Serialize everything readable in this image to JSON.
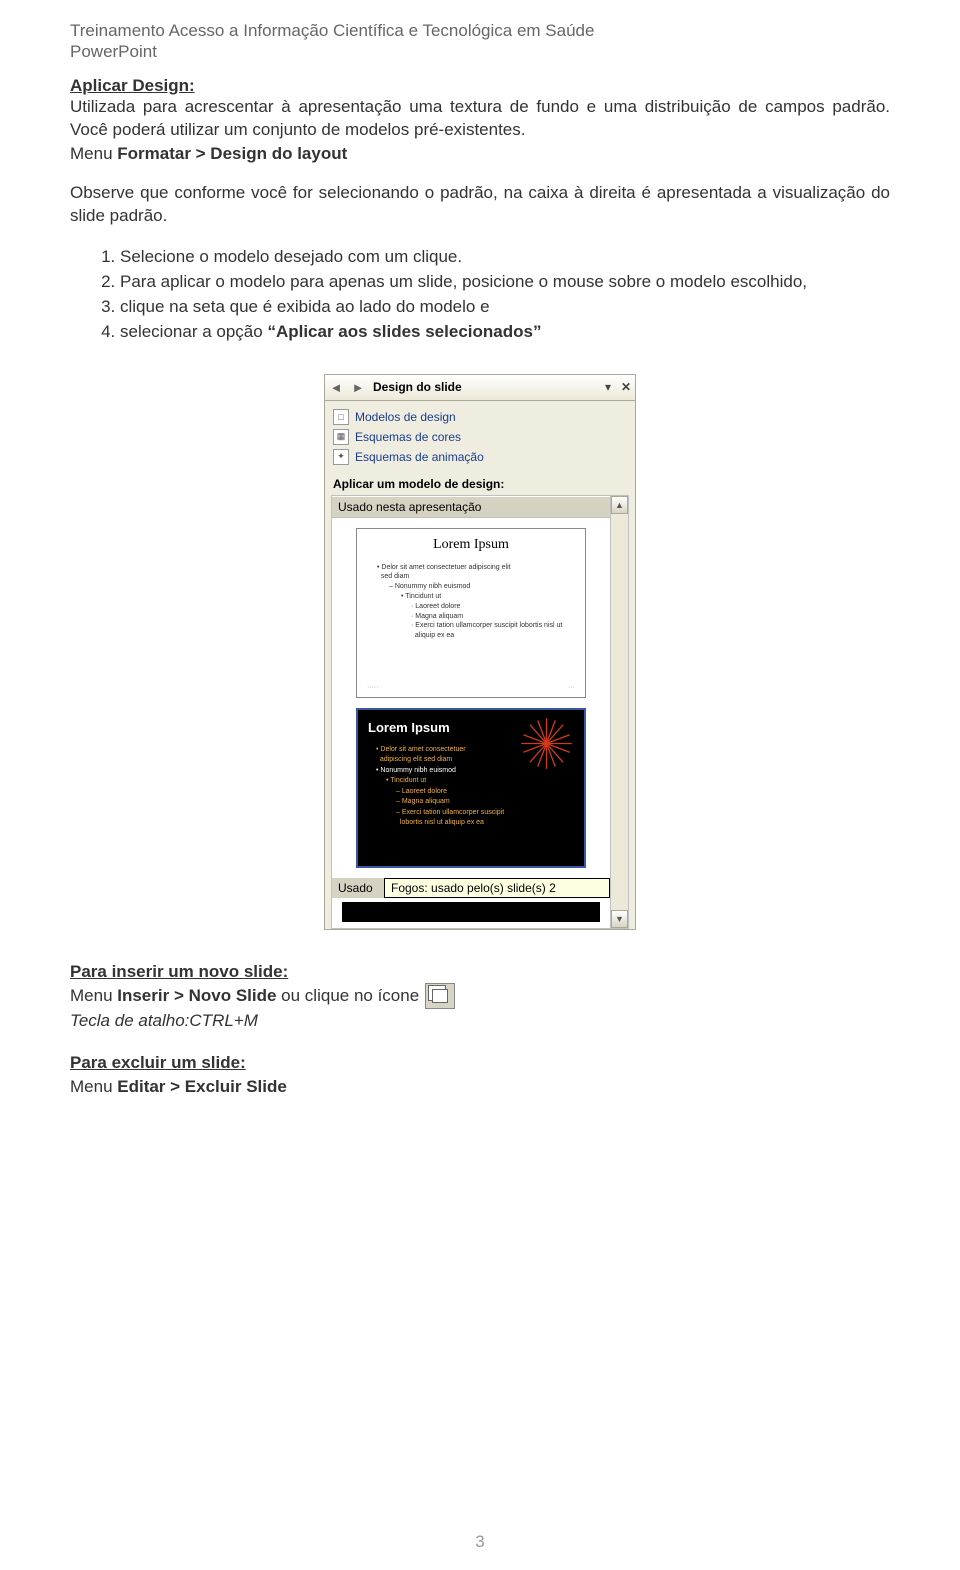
{
  "header": {
    "title": "Treinamento Acesso a Informação Científica e Tecnológica em Saúde",
    "subtitle": "PowerPoint"
  },
  "section1": {
    "title": "Aplicar Design:",
    "para": "Utilizada para acrescentar à apresentação uma textura de fundo e uma distribuição de campos padrão. Você poderá utilizar um conjunto de modelos pré-existentes.",
    "menu_prefix": "Menu ",
    "menu_bold": "Formatar > Design do layout",
    "observe": "Observe que conforme você for selecionando o padrão, na caixa à direita é apresentada a visualização do slide padrão.",
    "steps": [
      "Selecione o modelo desejado com um clique.",
      "Para aplicar o modelo para apenas um slide, posicione o mouse sobre o modelo escolhido,",
      "clique na seta que é exibida ao lado do modelo e",
      "selecionar a opção “Aplicar aos slides selecionados”"
    ],
    "step4_prefix": "selecionar a opção ",
    "step4_bold": "“Aplicar aos slides selecionados”"
  },
  "taskpane": {
    "title": "Design do slide",
    "links": [
      {
        "icon": "□",
        "label": "Modelos de design"
      },
      {
        "icon": "▦",
        "label": "Esquemas de cores"
      },
      {
        "icon": "✦",
        "label": "Esquemas de animação"
      }
    ],
    "apply_label": "Aplicar um modelo de design:",
    "group_used": "Usado nesta apresentação",
    "group_used2": "Usado",
    "tooltip": "Fogos: usado pelo(s) slide(s) 2",
    "thumb_title": "Lorem Ipsum",
    "thumb_lines": [
      "Delor sit amet consectetuer adipiscing elit",
      "sed diam",
      "Nonummy nibh euismod",
      "Tincidunt ut",
      "Laoreet dolore",
      "Magna aliquam",
      "Exerci tation ullamcorper suscipit lobortis nisl ut",
      "aliquip ex ea"
    ],
    "dark_thumb_title": "Lorem Ipsum",
    "dark_lines": [
      "Delor sit amet consectetuer",
      "adipiscing elit sed diam",
      "Nonummy nibh euismod",
      "Tincidunt ut",
      "Laoreet dolore",
      "Magna aliquam",
      "Exerci tation ullamcorper suscipit",
      "lobortis nisl ut aliquip ex ea"
    ]
  },
  "insert": {
    "title": "Para inserir um novo slide:",
    "line_prefix": " Menu ",
    "line_bold": "Inserir > Novo Slide",
    "line_suffix": " ou clique no ícone",
    "shortcut": "Tecla de atalho:CTRL+M"
  },
  "delete": {
    "title": "Para excluir um slide:",
    "line_prefix": " Menu ",
    "line_bold": "Editar > Excluir Slide"
  },
  "page_number": "3"
}
